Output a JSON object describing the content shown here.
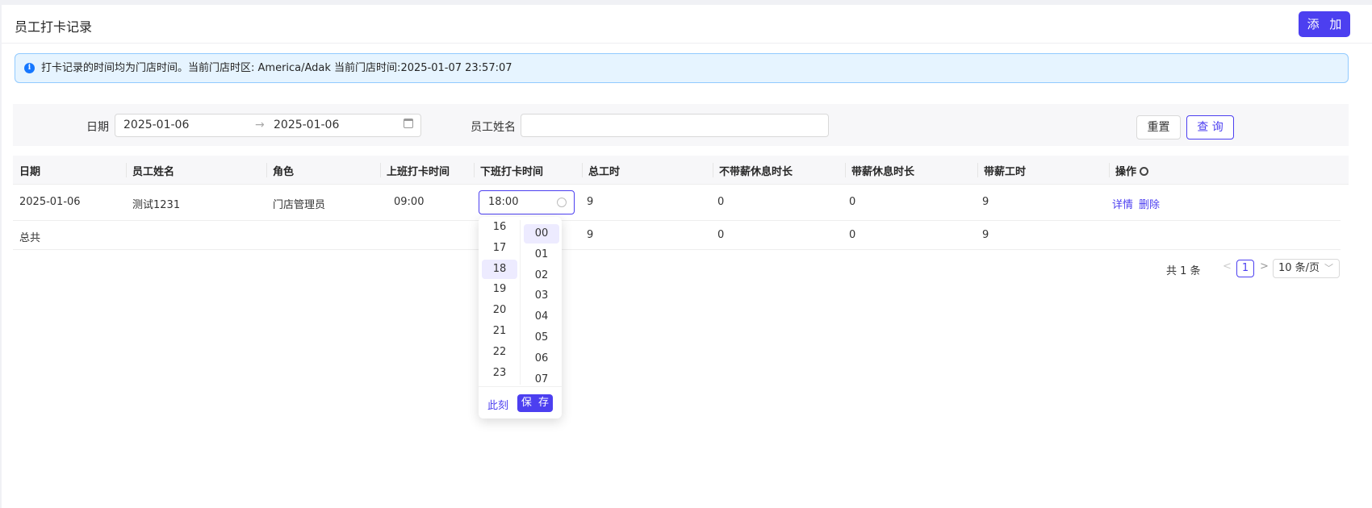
{
  "header": {
    "title": "员工打卡记录",
    "add_label": "添 加"
  },
  "alert": {
    "icon": "info-icon",
    "text": "打卡记录的时间均为门店时间。当前门店时区: America/Adak 当前门店时间:2025-01-07 23:57:07"
  },
  "filter": {
    "date_label": "日期",
    "date_start": "2025-01-06",
    "date_end": "2025-01-06",
    "range_separator": "→",
    "name_label": "员工姓名",
    "name_value": "",
    "reset_label": "重置",
    "query_label": "查 询"
  },
  "table": {
    "columns": [
      "日期",
      "员工姓名",
      "角色",
      "上班打卡时间",
      "下班打卡时间",
      "总工时",
      "不带薪休息时长",
      "带薪休息时长",
      "带薪工时",
      "操作"
    ],
    "rows": [
      {
        "date": "2025-01-06",
        "name": "测试1231",
        "role": "门店管理员",
        "clock_in": "09:00",
        "clock_out": "18:00",
        "total_hours": "9",
        "unpaid_break": "0",
        "paid_break": "0",
        "paid_hours": "9",
        "detail_label": "详情",
        "delete_label": "删除"
      }
    ],
    "summary": {
      "label": "总共",
      "total_hours": "9",
      "unpaid_break": "0",
      "paid_break": "0",
      "paid_hours": "9"
    }
  },
  "pagination": {
    "total_text": "共 1 条",
    "prev": "<",
    "current_page": "1",
    "next": ">",
    "page_size": "10 条/页"
  },
  "time_picker": {
    "hours": [
      "16",
      "17",
      "18",
      "19",
      "20",
      "21",
      "22",
      "23"
    ],
    "minutes": [
      "00",
      "01",
      "02",
      "03",
      "04",
      "05",
      "06",
      "07"
    ],
    "selected_hour": "18",
    "selected_minute": "00",
    "now_label": "此刻",
    "save_label": "保 存"
  },
  "colors": {
    "accent": "#4c3ff0",
    "alert_bg": "#e6f4ff",
    "alert_border": "#91caff",
    "info": "#1677ff"
  }
}
